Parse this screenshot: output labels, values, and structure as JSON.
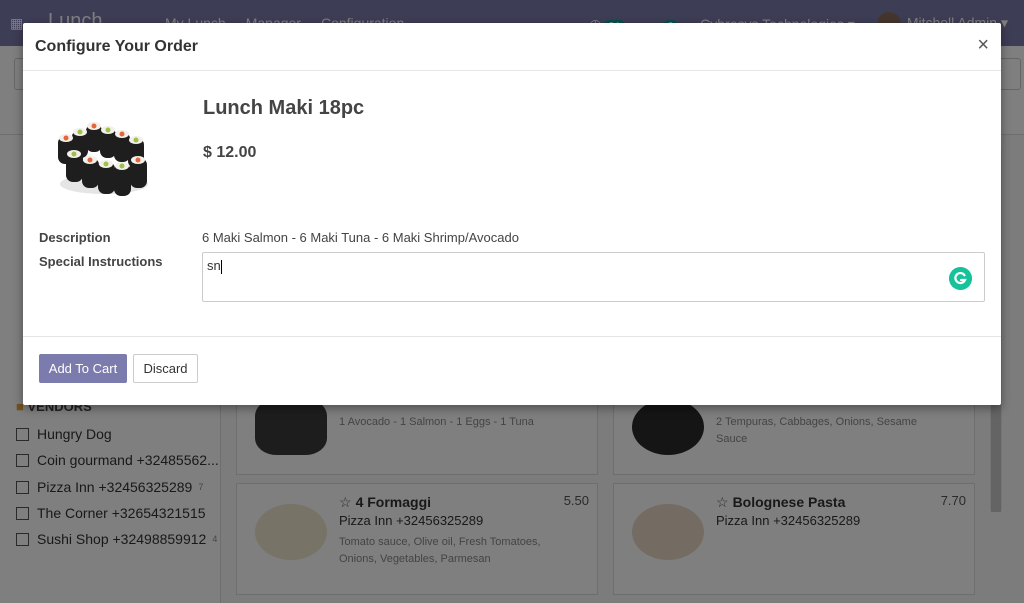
{
  "navbar": {
    "brand": "Lunch",
    "menu": [
      "My Lunch",
      "Manager",
      "Configuration"
    ],
    "activity_count": "24",
    "message_count": "2",
    "company": "Cybrosys Technologies",
    "user": "Mitchell Admin"
  },
  "sidebar": {
    "vendors_title": "VENDORS",
    "vendors": [
      {
        "label": "Hungry Dog",
        "count": ""
      },
      {
        "label": "Coin gourmand +32485562...",
        "count": ""
      },
      {
        "label": "Pizza Inn +32456325289",
        "count": "7"
      },
      {
        "label": "The Corner +32654321515",
        "count": ""
      },
      {
        "label": "Sushi Shop +32498859912",
        "count": "4"
      }
    ]
  },
  "cards": [
    {
      "name": "",
      "vendor": "",
      "desc": "1 Avocado - 1 Salmon - 1 Eggs - 1 Tuna",
      "price": ""
    },
    {
      "name": "",
      "vendor": "",
      "desc": "2 Tempuras, Cabbages, Onions, Sesame Sauce",
      "price": ""
    },
    {
      "name": "4 Formaggi",
      "vendor": "Pizza Inn +32456325289",
      "desc": "Tomato sauce, Olive oil, Fresh Tomatoes, Onions, Vegetables, Parmesan",
      "price": "5.50"
    },
    {
      "name": "Bolognese Pasta",
      "vendor": "Pizza Inn +32456325289",
      "desc": "",
      "price": "7.70"
    }
  ],
  "modal": {
    "title": "Configure Your Order",
    "close": "×",
    "product_name": "Lunch Maki 18pc",
    "price": "$ 12.00",
    "description_label": "Description",
    "description": "6 Maki Salmon - 6 Maki Tuna - 6 Maki Shrimp/Avocado",
    "instructions_label": "Special Instructions",
    "instructions_value": "sn",
    "add_to_cart": "Add To Cart",
    "discard": "Discard"
  }
}
